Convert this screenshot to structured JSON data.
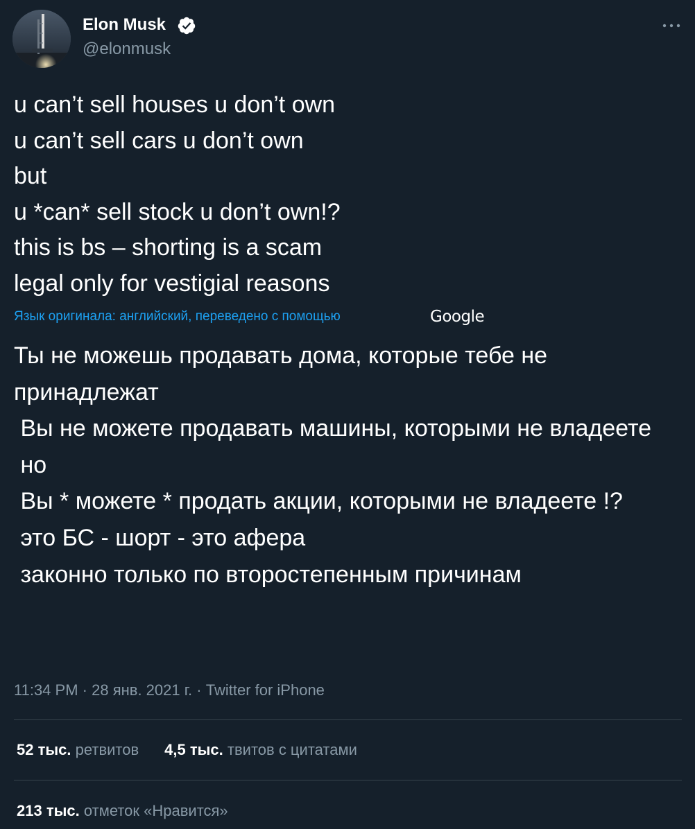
{
  "author": {
    "display_name": "Elon Musk",
    "handle": "@elonmusk",
    "verified": true,
    "verified_icon": "verified-badge-icon",
    "avatar_icon": "rocket-launch-avatar"
  },
  "more_icon": "more-dots-icon",
  "tweet": {
    "text": "u can’t sell houses u don’t own\nu can’t sell cars u don’t own\nbut\nu *can* sell stock u don’t own!?\nthis is bs – shorting is a scam\nlegal only for vestigial reasons"
  },
  "translation": {
    "note": "Язык оригинала: английский, переведено с помощью",
    "provider": "Google",
    "text": "Ты не можешь продавать дома, которые тебе не принадлежат\n Вы не можете продавать машины, которыми не владеете\n но\n Вы * можете * продать акции, которыми не владеете !?\n это БС - шорт - это афера\n законно только по второстепенным причинам"
  },
  "meta": {
    "time": "11:34 PM",
    "date": "28 янв. 2021 г.",
    "separator": " · ",
    "source": "Twitter for iPhone"
  },
  "stats": {
    "retweets_count": "52 тыс.",
    "retweets_label": "ретвитов",
    "quotes_count": "4,5 тыс.",
    "quotes_label": "твитов с цитатами",
    "likes_count": "213 тыс.",
    "likes_label": "отметок «Нравится»"
  },
  "colors": {
    "background": "#15202b",
    "text": "#ffffff",
    "secondary": "#8899a6",
    "link": "#1da1f2",
    "divider": "#38444d"
  }
}
